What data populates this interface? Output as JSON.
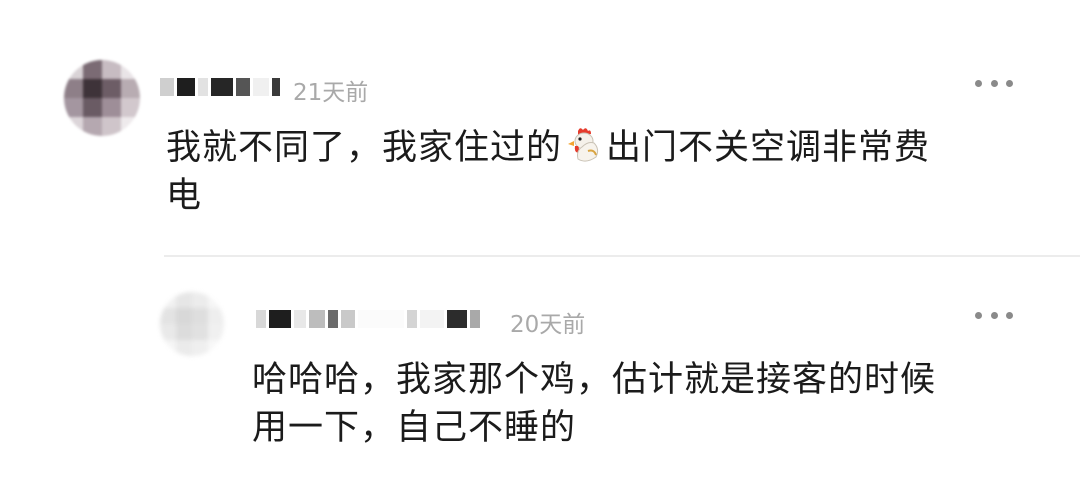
{
  "comments": [
    {
      "time": "21天前",
      "text_line1_before": "我就不同了，我家住过的",
      "icon": "rooster-emoji",
      "text_line1_after": "出门不关空调非常费",
      "text_line2": "电"
    },
    {
      "time": "20天前",
      "text_line1": "哈哈哈，我家那个鸡，估计就是接客的时候",
      "text_line2": "用一下，自己不睡的"
    }
  ]
}
